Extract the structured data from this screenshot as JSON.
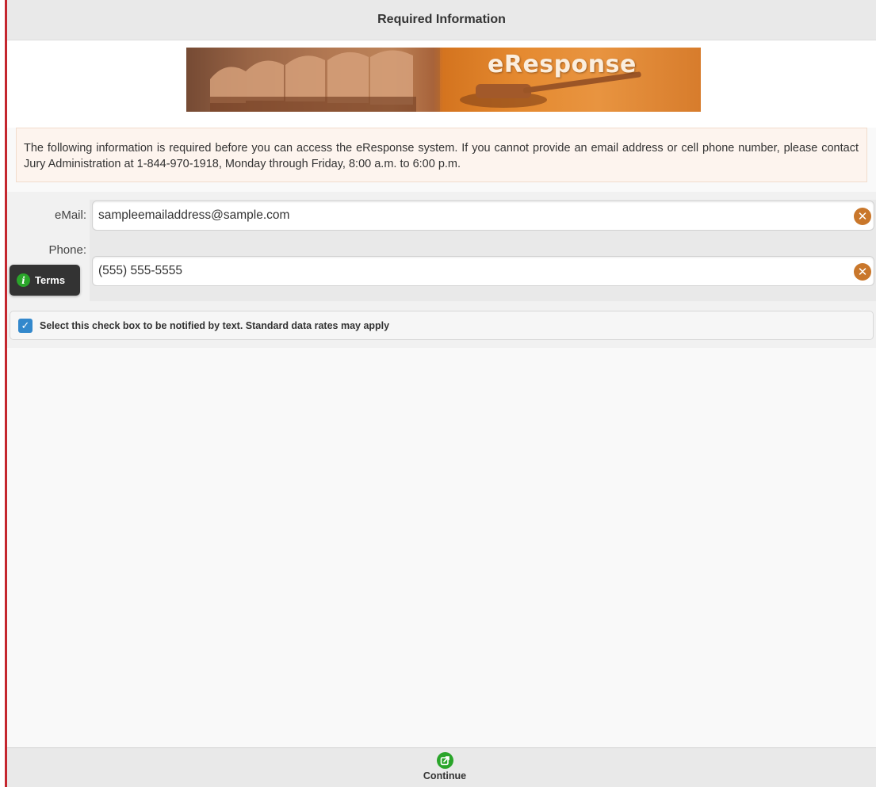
{
  "header": {
    "title": "Required Information"
  },
  "banner": {
    "logo_text": "eResponse"
  },
  "notice": {
    "text": "The following information is required before you can access the eResponse system. If you cannot provide an email address or cell phone number, please contact Jury Administration at 1-844-970-1918, Monday through Friday, 8:00 a.m. to 6:00 p.m."
  },
  "form": {
    "email": {
      "label": "eMail:",
      "value": "sampleemailaddress@sample.com"
    },
    "phone": {
      "label": "Phone:",
      "value": "(555) 555-5555"
    },
    "terms_label": "Terms",
    "sms_checkbox": {
      "label": "Select this check box to be notified by text. Standard data rates may apply",
      "checked": true
    }
  },
  "footer": {
    "continue_label": "Continue"
  },
  "colors": {
    "accent_red": "#c4262e",
    "clear_icon": "#c9772b",
    "checkbox": "#3388cc",
    "green_icon": "#2aa52a"
  }
}
